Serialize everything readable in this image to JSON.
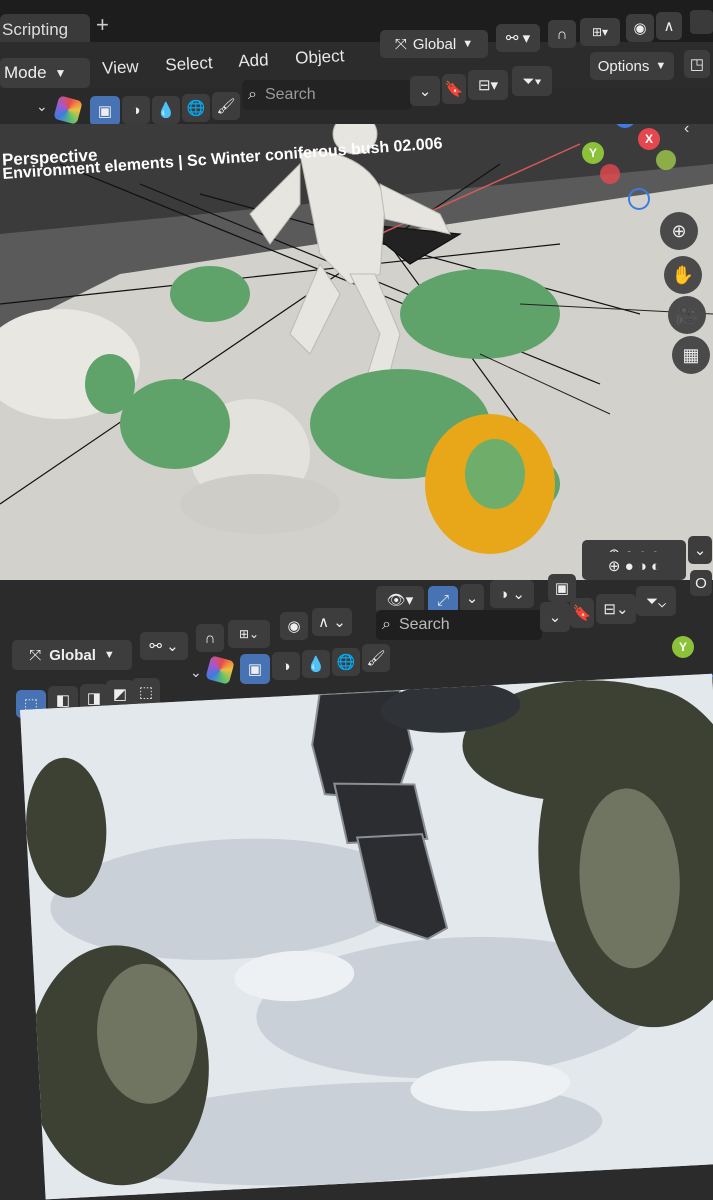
{
  "top_window": {
    "workspace_tab": "Scripting",
    "add_tab": "+",
    "transform_orientation": "Global",
    "mode": "Mode",
    "menus": [
      "View",
      "Select",
      "Add",
      "Object"
    ],
    "options_label": "Options",
    "search_placeholder": "Search",
    "viewport": {
      "view_name": "Perspective",
      "collection_info": "Environment elements | Sc Winter coniferous bush 02.006"
    },
    "gizmo_axes": [
      "Z",
      "Y",
      "X"
    ]
  },
  "bottom_window": {
    "transform_orientation": "Global",
    "search_placeholder": "Search",
    "gizmo_axes": [
      "Y"
    ]
  },
  "colors": {
    "selection_orange": "#e8a619",
    "foliage_green": "#5fa36b",
    "axis_x": "#e4484e",
    "axis_y": "#8bc23a",
    "axis_z": "#3d7be0",
    "active_blue": "#4772b3"
  }
}
